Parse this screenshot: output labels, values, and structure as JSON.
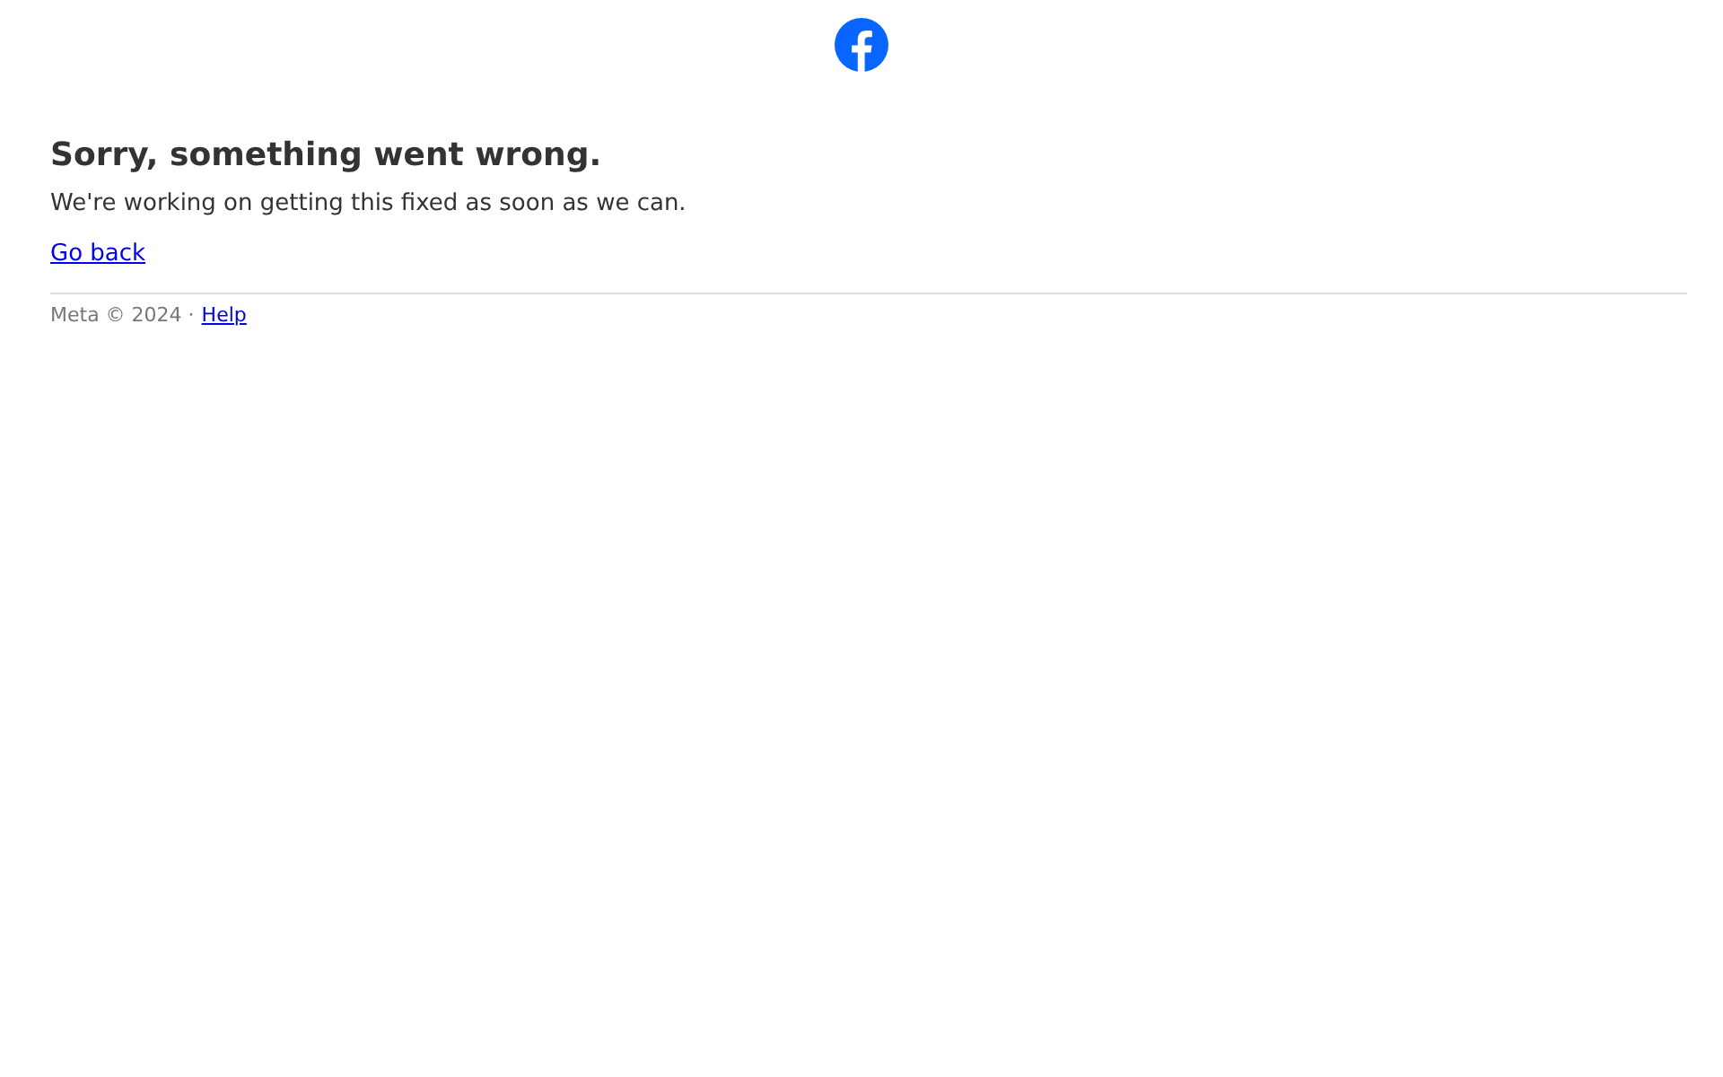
{
  "heading": "Sorry, something went wrong.",
  "message": "We're working on getting this fixed as soon as we can.",
  "back_link": "Go back",
  "footer": {
    "copyright": "Meta © 2024 ·",
    "link": "Help"
  }
}
